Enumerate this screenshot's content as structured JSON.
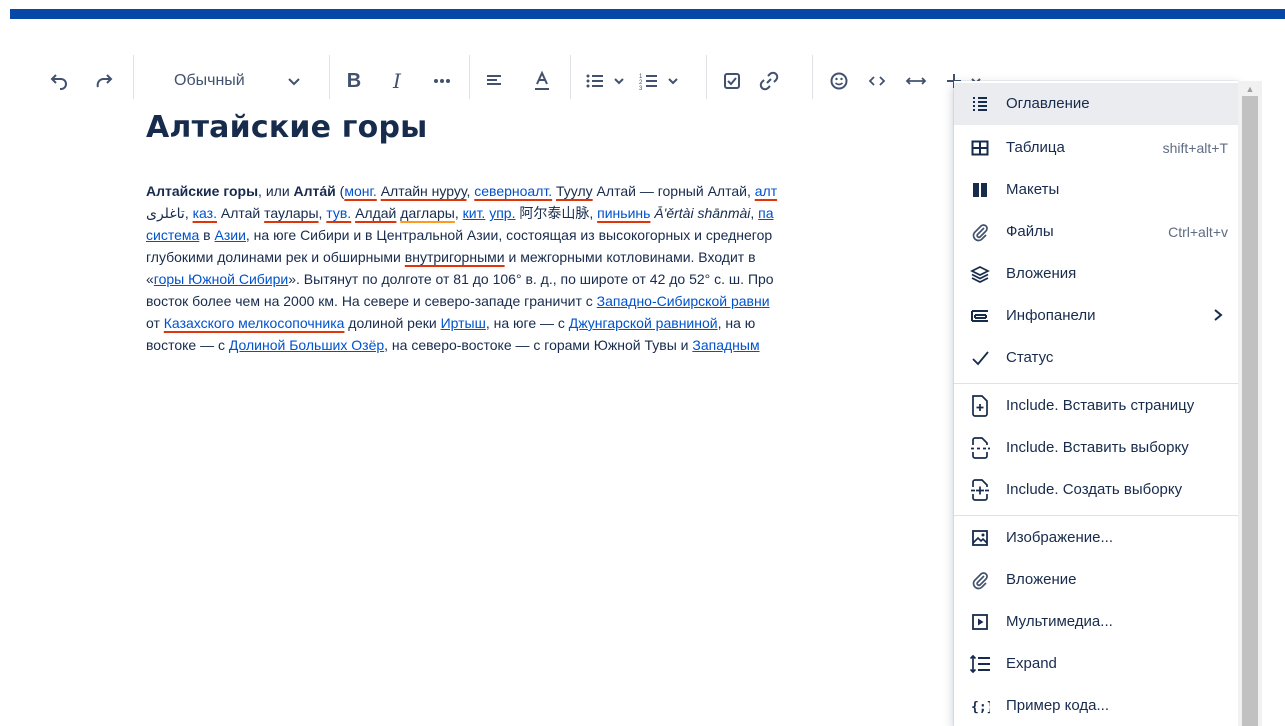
{
  "toolbar": {
    "style_label": "Обычный",
    "icons": [
      "undo-icon",
      "redo-icon",
      "chevron-down-icon",
      "bold-icon",
      "italic-icon",
      "more-icon",
      "align-left-icon",
      "text-color-icon",
      "bullet-list-icon",
      "chevron-down-icon",
      "numbered-list-icon",
      "chevron-down-icon",
      "checkbox-icon",
      "link-icon",
      "emoji-icon",
      "code-icon",
      "expand-width-icon",
      "plus-icon",
      "chevron-down-icon"
    ]
  },
  "document": {
    "title": "Алтайские горы",
    "lines": [
      [
        {
          "t": "Алтайские горы",
          "b": true
        },
        {
          "t": ", или "
        },
        {
          "t": "Алта́й",
          "b": true
        },
        {
          "t": " ("
        },
        {
          "t": "монг.",
          "link": true,
          "sp": true
        },
        {
          "t": " "
        },
        {
          "t": "Алтайн нуруу",
          "sp": true
        },
        {
          "t": ", "
        },
        {
          "t": "северноалт.",
          "link": true,
          "sp": true
        },
        {
          "t": " "
        },
        {
          "t": "Туулу",
          "sp": true
        },
        {
          "t": " Алтай — горный Алтай, "
        },
        {
          "t": "алт",
          "link": true,
          "sp": true
        }
      ],
      [
        {
          "t": "تاغلرى, "
        },
        {
          "t": "каз.",
          "link": true,
          "sp": true
        },
        {
          "t": " Алтай "
        },
        {
          "t": "таулары",
          "sp": true
        },
        {
          "t": ", "
        },
        {
          "t": "тув.",
          "link": true,
          "sp": true
        },
        {
          "t": " "
        },
        {
          "t": "Алдай",
          "sp": true
        },
        {
          "t": " "
        },
        {
          "t": "даглары",
          "spo": true
        },
        {
          "t": ", "
        },
        {
          "t": "кит.",
          "link": true
        },
        {
          "t": " "
        },
        {
          "t": "упр.",
          "link": true
        },
        {
          "t": " 阿尔泰山脉, "
        },
        {
          "t": "пиньинь",
          "link": true,
          "sp": true
        },
        {
          "t": " "
        },
        {
          "t": "Ā'ěrtài shānmài",
          "i": true
        },
        {
          "t": ", "
        },
        {
          "t": "па",
          "link": true
        }
      ],
      [
        {
          "t": "система",
          "link": true
        },
        {
          "t": " в "
        },
        {
          "t": "Азии",
          "link": true
        },
        {
          "t": ", на юге Сибири и в Центральной Азии, состоящая из высокогорных и среднегор"
        }
      ],
      [
        {
          "t": "глубокими долинами рек и обширными "
        },
        {
          "t": "внутригорными",
          "sp": true
        },
        {
          "t": " и межгорными котловинами. Входит в"
        }
      ],
      [
        {
          "t": "«"
        },
        {
          "t": "горы Южной Сибири",
          "link": true
        },
        {
          "t": "». Вытянут по долготе от 81 до 106° в. д., по широте от 42 до 52° с. ш. Про"
        }
      ],
      [
        {
          "t": "восток более чем на 2000 км. На севере и северо-западе граничит с "
        },
        {
          "t": "Западно-Сибирской равни",
          "link": true
        }
      ],
      [
        {
          "t": "от "
        },
        {
          "t": "Казахского мелкосопочника",
          "link": true,
          "sp": true
        },
        {
          "t": " долиной реки "
        },
        {
          "t": "Иртыш",
          "link": true
        },
        {
          "t": ", на юге — с "
        },
        {
          "t": "Джунгарской равниной",
          "link": true
        },
        {
          "t": ", на ю"
        }
      ],
      [
        {
          "t": "востоке — с "
        },
        {
          "t": "Долиной Больших Озёр",
          "link": true
        },
        {
          "t": ", на северо-востоке — с горами Южной Тувы и "
        },
        {
          "t": "Западным",
          "link": true
        }
      ]
    ]
  },
  "menu": {
    "items": [
      {
        "label": "Оглавление",
        "icon": "table-of-contents-icon",
        "shortcut": "",
        "active": true
      },
      {
        "label": "Таблица",
        "icon": "table-icon",
        "shortcut": "shift+alt+T"
      },
      {
        "label": "Макеты",
        "icon": "layouts-icon",
        "shortcut": ""
      },
      {
        "label": "Файлы",
        "icon": "paperclip-icon",
        "shortcut": "Ctrl+alt+v"
      },
      {
        "label": "Вложения",
        "icon": "layers-icon",
        "shortcut": ""
      },
      {
        "label": "Инфопанели",
        "icon": "info-panel-icon",
        "shortcut": "",
        "submenu": true
      },
      {
        "label": "Статус",
        "icon": "checkmark-icon",
        "shortcut": ""
      },
      {
        "label": "Include. Вставить страницу",
        "icon": "include-page-icon",
        "shortcut": ""
      },
      {
        "label": "Include. Вставить выборку",
        "icon": "include-excerpt-icon",
        "shortcut": ""
      },
      {
        "label": "Include. Создать выборку",
        "icon": "create-excerpt-icon",
        "shortcut": ""
      },
      {
        "label": "Изображение...",
        "icon": "image-icon",
        "shortcut": ""
      },
      {
        "label": "Вложение",
        "icon": "paperclip-icon",
        "shortcut": ""
      },
      {
        "label": "Мультимедиа...",
        "icon": "play-icon",
        "shortcut": ""
      },
      {
        "label": "Expand",
        "icon": "expand-icon",
        "shortcut": ""
      },
      {
        "label": "Пример кода...",
        "icon": "code-block-icon",
        "shortcut": ""
      }
    ]
  }
}
